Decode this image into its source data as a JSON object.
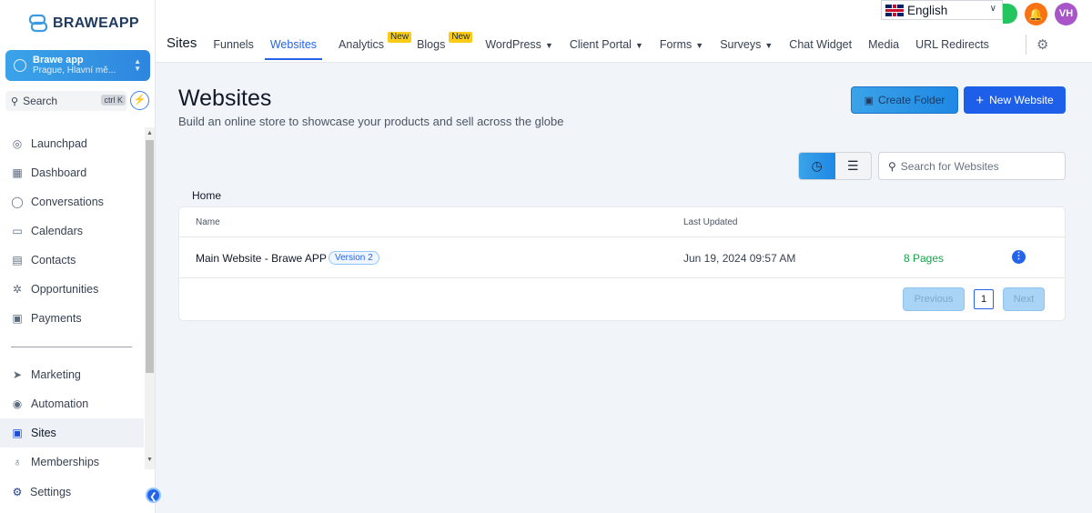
{
  "app": {
    "logo_text": "BRAWEAPP"
  },
  "account": {
    "name": "Brawe app",
    "location": "Prague, Hlavní mě..."
  },
  "sidebar": {
    "search_label": "Search",
    "search_shortcut": "ctrl K",
    "items": [
      {
        "label": "Launchpad",
        "icon": "rocket-icon"
      },
      {
        "label": "Dashboard",
        "icon": "grid-icon"
      },
      {
        "label": "Conversations",
        "icon": "chat-icon"
      },
      {
        "label": "Calendars",
        "icon": "calendar-icon"
      },
      {
        "label": "Contacts",
        "icon": "contacts-icon"
      },
      {
        "label": "Opportunities",
        "icon": "network-icon"
      },
      {
        "label": "Payments",
        "icon": "receipt-icon"
      }
    ],
    "items2": [
      {
        "label": "Marketing",
        "icon": "send-icon"
      },
      {
        "label": "Automation",
        "icon": "automation-icon"
      },
      {
        "label": "Sites",
        "icon": "sites-icon",
        "active": true
      },
      {
        "label": "Memberships",
        "icon": "award-icon"
      }
    ],
    "settings_label": "Settings"
  },
  "topbar": {
    "section_title": "Sites",
    "tabs": [
      {
        "label": "Funnels"
      },
      {
        "label": "Websites",
        "active": true
      },
      {
        "label": "Analytics",
        "badge": "New"
      },
      {
        "label": "Blogs",
        "badge": "New"
      },
      {
        "label": "WordPress",
        "dropdown": true
      },
      {
        "label": "Client Portal",
        "dropdown": true
      },
      {
        "label": "Forms",
        "dropdown": true
      },
      {
        "label": "Surveys",
        "dropdown": true
      },
      {
        "label": "Chat Widget"
      },
      {
        "label": "Media"
      },
      {
        "label": "URL Redirects"
      }
    ],
    "language": "English",
    "avatar_initials": "VH"
  },
  "main": {
    "title": "Websites",
    "subtitle": "Build an online store to showcase your products and sell across the globe",
    "create_folder_label": "Create Folder",
    "new_website_label": "New Website",
    "search_placeholder": "Search for Websites",
    "breadcrumb": "Home",
    "table": {
      "headers": {
        "name": "Name",
        "last_updated": "Last Updated"
      },
      "rows": [
        {
          "name": "Main Website - Brawe APP",
          "version": "Version 2",
          "last_updated": "Jun 19, 2024 09:57 AM",
          "pages": "8 Pages"
        }
      ]
    },
    "pagination": {
      "previous": "Previous",
      "current_page": "1",
      "next": "Next"
    }
  },
  "colors": {
    "primary": "#1d5fe8",
    "accent_gradient_start": "#3ba3e8",
    "badge_new": "#facc15",
    "pages_green": "#16a34a"
  }
}
